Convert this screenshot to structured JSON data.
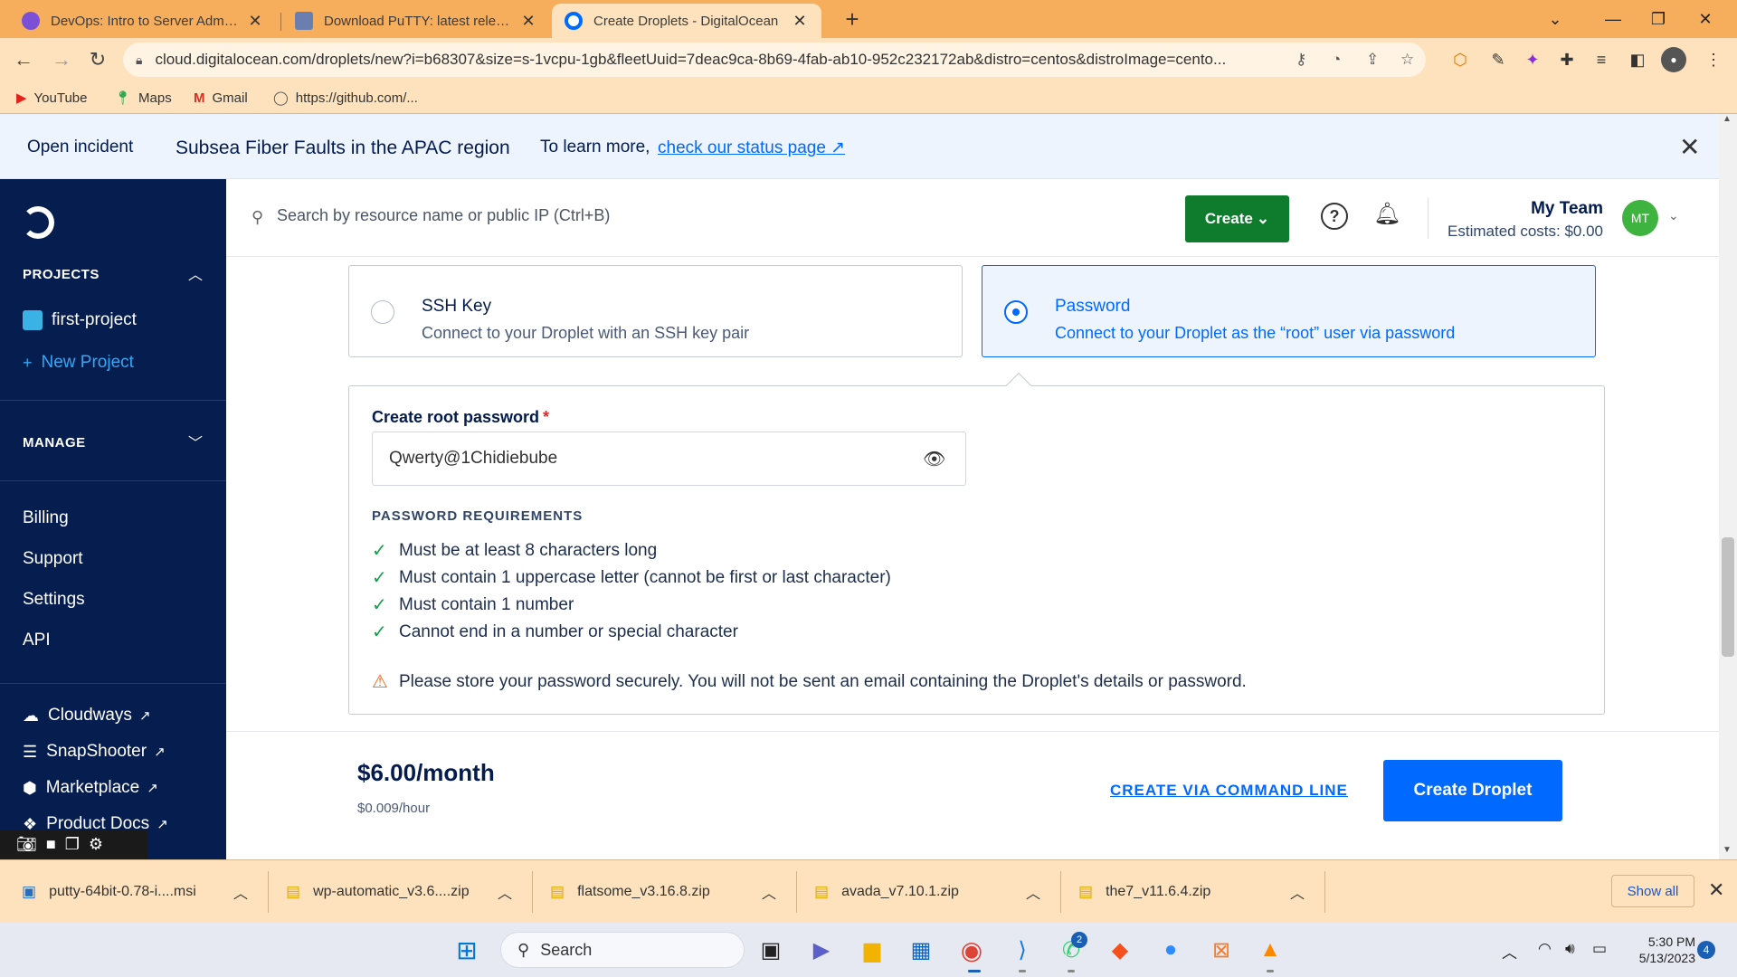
{
  "browser": {
    "tabs": [
      {
        "label": "DevOps: Intro to Server Administ",
        "favicon_color": "#7b4fd6",
        "active": false
      },
      {
        "label": "Download PuTTY: latest release (",
        "favicon_color": "#6a7fb0",
        "active": false
      },
      {
        "label": "Create Droplets - DigitalOcean",
        "favicon_color": "#0069ff",
        "active": true
      }
    ],
    "url": "cloud.digitalocean.com/droplets/new?i=b68307&size=s-1vcpu-1gb&fleetUuid=7deac9ca-8b69-4fab-ab10-952c232172ab&distro=centos&distroImage=cento...",
    "bookmarks": [
      {
        "label": "YouTube",
        "icon": "youtube-icon"
      },
      {
        "label": "Maps",
        "icon": "maps-icon"
      },
      {
        "label": "Gmail",
        "icon": "gmail-icon"
      },
      {
        "label": "https://github.com/...",
        "icon": "github-icon"
      }
    ]
  },
  "incident": {
    "label": "Open incident",
    "title": "Subsea Fiber Faults in the APAC region",
    "more_text": "To learn more,",
    "link_text": "check our status page"
  },
  "sidebar": {
    "projects_heading": "PROJECTS",
    "projects": [
      {
        "label": "first-project"
      }
    ],
    "new_project_label": "New Project",
    "manage_heading": "MANAGE",
    "links": [
      {
        "label": "Billing"
      },
      {
        "label": "Support"
      },
      {
        "label": "Settings"
      },
      {
        "label": "API"
      }
    ],
    "external": [
      {
        "label": "Cloudways",
        "icon": "cloud-icon"
      },
      {
        "label": "SnapShooter",
        "icon": "snapshooter-icon"
      },
      {
        "label": "Marketplace",
        "icon": "marketplace-icon"
      },
      {
        "label": "Product Docs",
        "icon": "docs-icon"
      }
    ]
  },
  "header": {
    "search_placeholder": "Search by resource name or public IP (Ctrl+B)",
    "create_label": "Create",
    "team_name": "My Team",
    "estimated_costs": "Estimated costs: $0.00",
    "avatar_initials": "MT"
  },
  "auth": {
    "options": [
      {
        "title": "SSH Key",
        "description": "Connect to your Droplet with an SSH key pair",
        "selected": false
      },
      {
        "title": "Password",
        "description": "Connect to your Droplet as the “root” user via password",
        "selected": true
      }
    ],
    "password_label": "Create root password",
    "required_mark": "*",
    "password_value": "Qwerty@1Chidiebube",
    "requirements_heading": "PASSWORD REQUIREMENTS",
    "requirements": [
      "Must be at least 8 characters long",
      "Must contain 1 uppercase letter (cannot be first or last character)",
      "Must contain 1 number",
      "Cannot end in a number or special character"
    ],
    "warning": "Please store your password securely. You will not be sent an email containing the Droplet's details or password."
  },
  "pricing": {
    "monthly": "$6.00/month",
    "hourly": "$0.009/hour",
    "cli_label": "CREATE VIA COMMAND LINE",
    "create_button": "Create Droplet"
  },
  "downloads": {
    "items": [
      {
        "label": "putty-64bit-0.78-i....msi",
        "icon": "installer-icon"
      },
      {
        "label": "wp-automatic_v3.6....zip",
        "icon": "zip-folder-icon"
      },
      {
        "label": "flatsome_v3.16.8.zip",
        "icon": "zip-folder-icon"
      },
      {
        "label": "avada_v7.10.1.zip",
        "icon": "zip-folder-icon"
      },
      {
        "label": "the7_v11.6.4.zip",
        "icon": "zip-folder-icon"
      }
    ],
    "show_all": "Show all"
  },
  "taskbar": {
    "search_label": "Search",
    "whatsapp_badge": "2",
    "time": "5:30 PM",
    "date": "5/13/2023",
    "notification_count": "4"
  },
  "colors": {
    "brand_blue": "#0069ff",
    "sidebar_navy": "#061d4f",
    "create_green": "#0f7b2d",
    "browser_theme": "#f6ae5d"
  }
}
